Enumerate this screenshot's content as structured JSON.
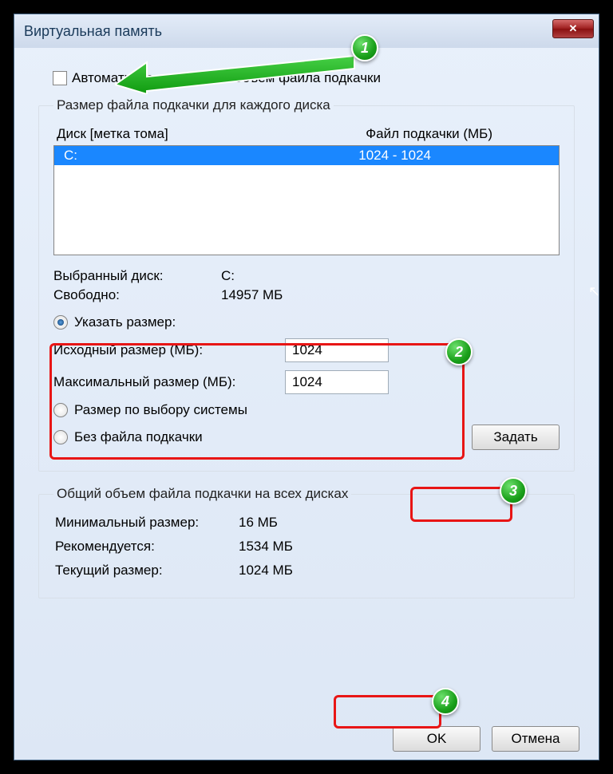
{
  "window": {
    "title": "Виртуальная память"
  },
  "auto_checkbox_label": "Автоматически выбирать объем файла подкачки",
  "fieldset1": {
    "legend": "Размер файла подкачки для каждого диска",
    "col_disk": "Диск [метка тома]",
    "col_file": "Файл подкачки (МБ)",
    "rows": [
      {
        "drive": "C:",
        "value": "1024 - 1024"
      }
    ],
    "selected_disk_label": "Выбранный диск:",
    "selected_disk_value": "C:",
    "free_label": "Свободно:",
    "free_value": "14957 МБ",
    "radio_custom": "Указать размер:",
    "initial_label": "Исходный размер (МБ):",
    "initial_value": "1024",
    "max_label": "Максимальный размер (МБ):",
    "max_value": "1024",
    "radio_system": "Размер по выбору системы",
    "radio_none": "Без файла подкачки",
    "set_button": "Задать"
  },
  "fieldset2": {
    "legend": "Общий объем файла подкачки на всех дисках",
    "min_label": "Минимальный размер:",
    "min_value": "16 МБ",
    "rec_label": "Рекомендуется:",
    "rec_value": "1534 МБ",
    "cur_label": "Текущий размер:",
    "cur_value": "1024 МБ"
  },
  "buttons": {
    "ok": "OK",
    "cancel": "Отмена"
  },
  "badges": {
    "b1": "1",
    "b2": "2",
    "b3": "3",
    "b4": "4"
  }
}
